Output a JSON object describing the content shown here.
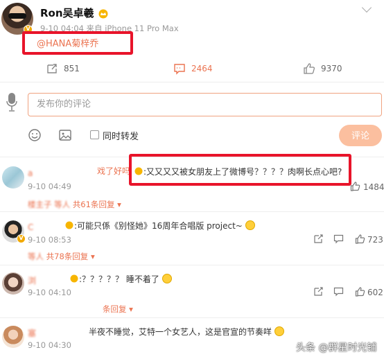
{
  "post": {
    "username": "Ron吴卓羲",
    "meta": "9-10 04:04  来自 iPhone 11 Pro Max",
    "mention": "@HANA菊梓乔",
    "repost_count": "851",
    "comment_count": "2464",
    "like_count": "9370"
  },
  "composer": {
    "placeholder": "发布你的评论",
    "repost_label": "同时转发",
    "submit_label": "评论"
  },
  "comments": [
    {
      "name": "a",
      "text_prefix": "戏了好吗",
      "text": ":又又又又被女朋友上了微博号？？？？肉啊长点心吧?",
      "time": "9-10 04:49",
      "reply_prefix": "楼主子 等人",
      "reply": "共61条回复",
      "like_count": "1484"
    },
    {
      "name": "C",
      "text": ":可能只係《别怪她》16周年合唱版 project~",
      "time": "9-10 08:53",
      "reply_prefix": "等人",
      "reply": "共78条回复",
      "like_count": "723"
    },
    {
      "name": "浏",
      "text": ":？？？？？  睡不着了",
      "time": "9-10 04:10",
      "reply_prefix": "",
      "reply": "条回复",
      "like_count": "602"
    },
    {
      "name": "塞",
      "text": "半夜不睡觉，艾特一个女艺人，这是官宣的节奏咩",
      "time": "9-10 04:30",
      "reply_prefix": "",
      "reply": "",
      "like_count": ""
    }
  ],
  "watermark": "头条 @群星时光铺",
  "colors": {
    "accent": "#eb7350",
    "highlight_box": "#e8142a",
    "submit_bg": "#fbbf9f"
  }
}
